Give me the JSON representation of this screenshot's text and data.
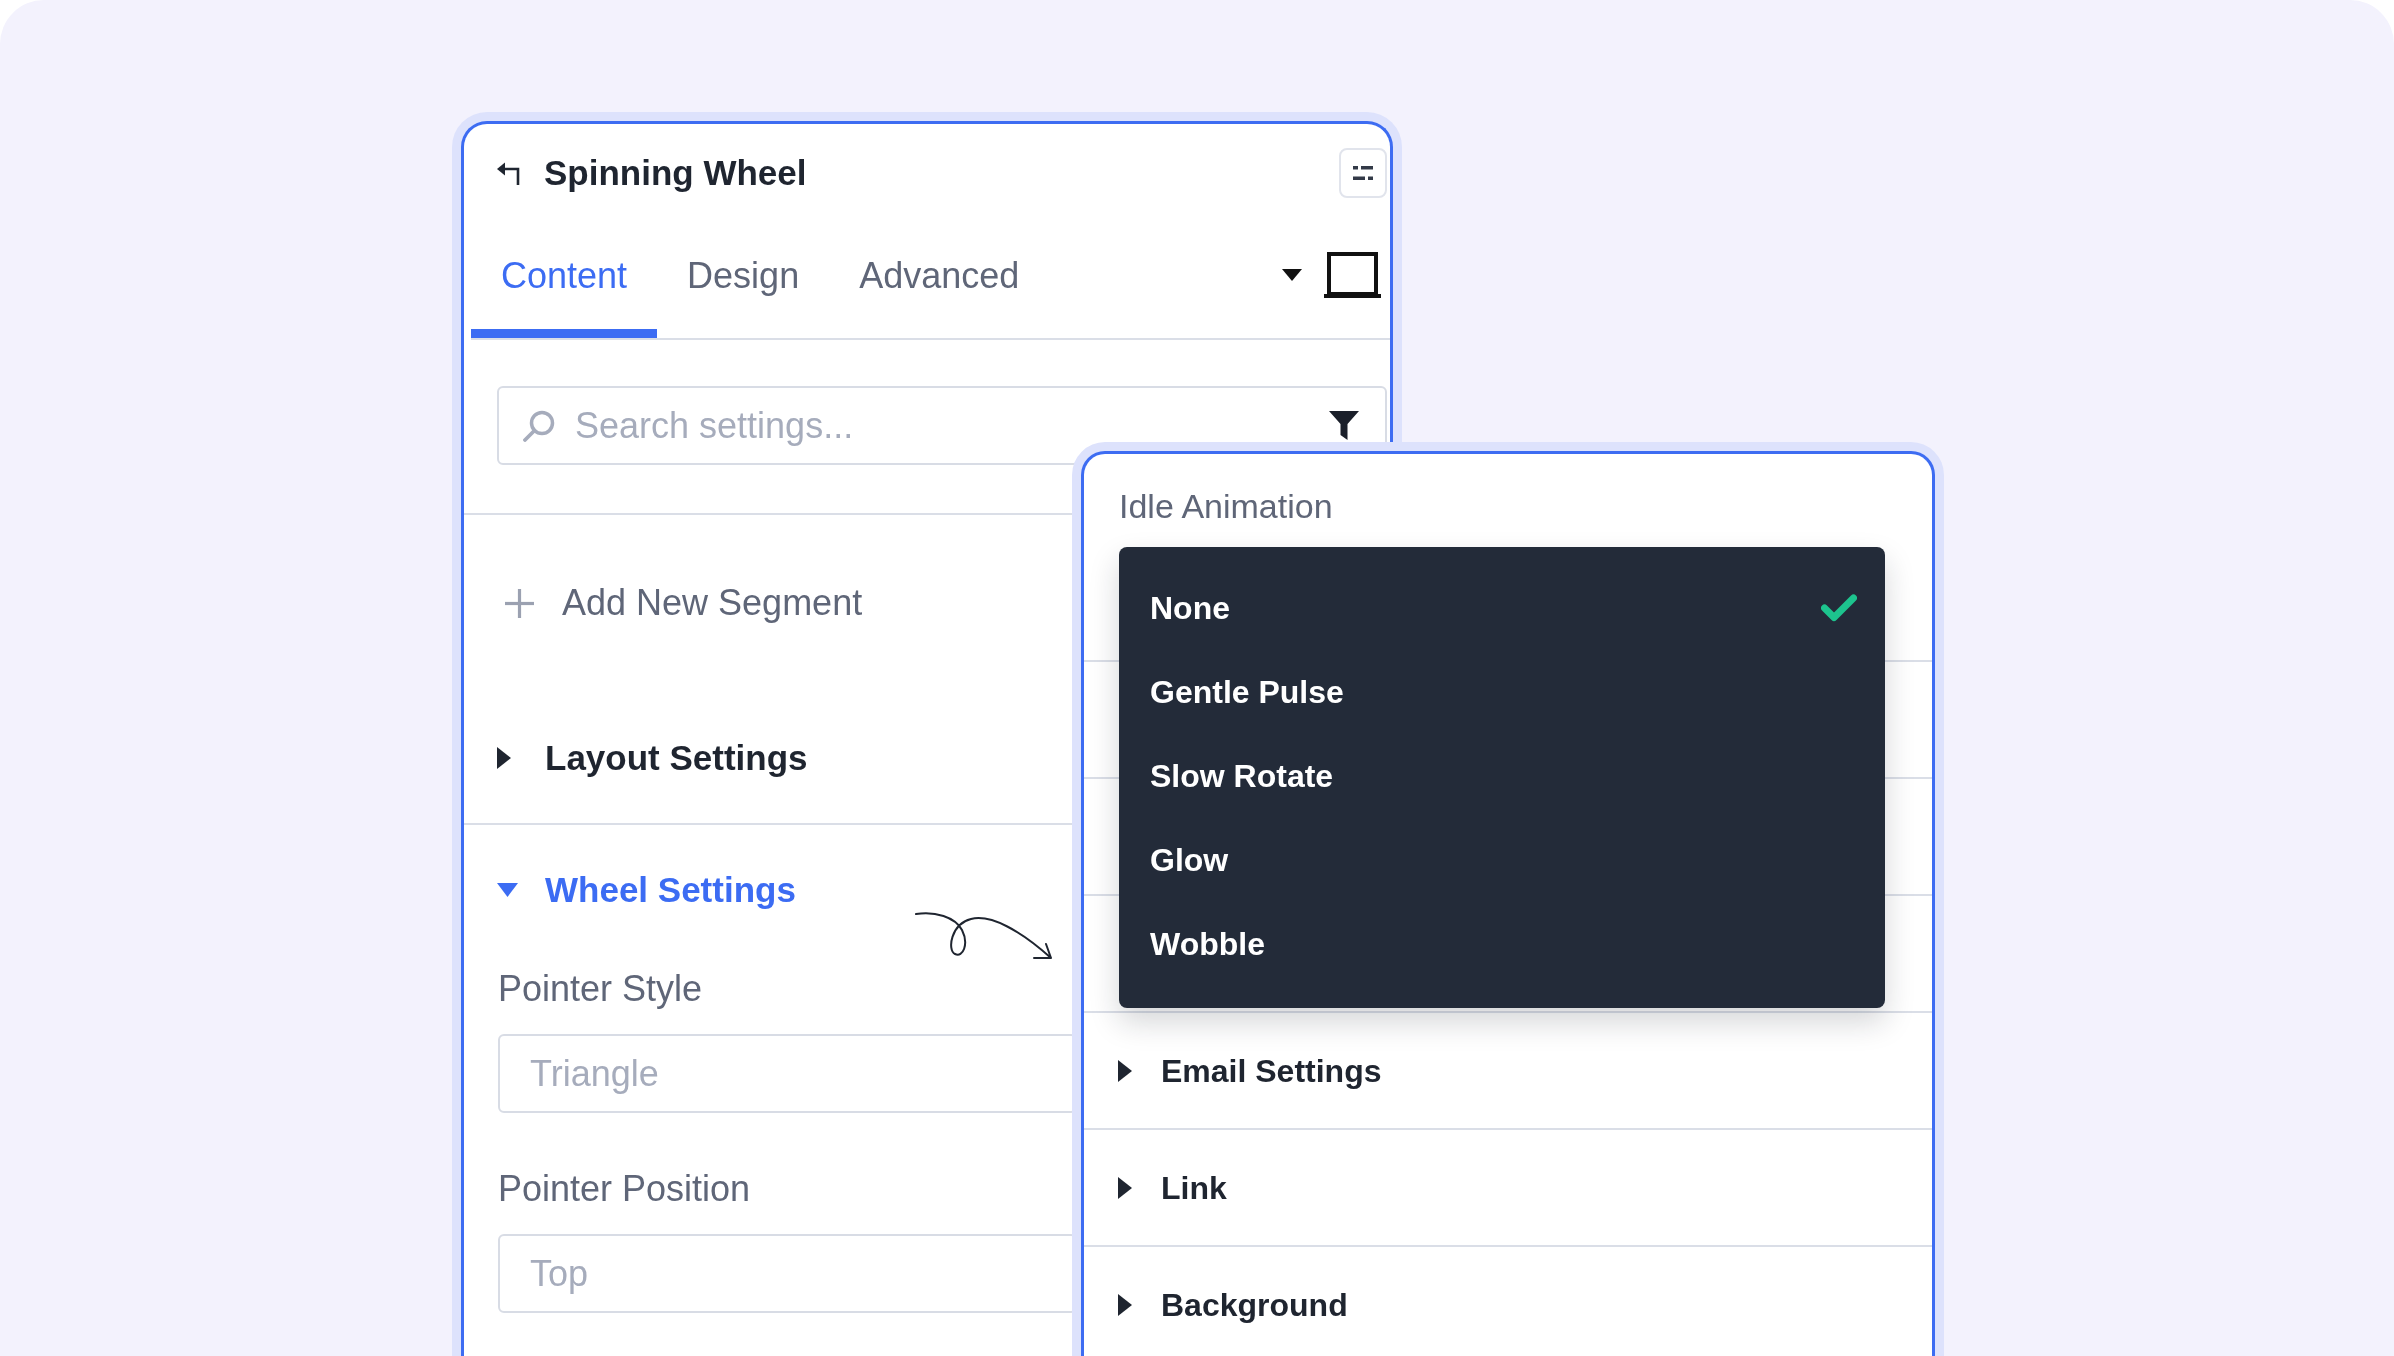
{
  "panel": {
    "title": "Spinning Wheel",
    "tabs": [
      {
        "label": "Content",
        "selected": true
      },
      {
        "label": "Design",
        "selected": false
      },
      {
        "label": "Advanced",
        "selected": false
      }
    ],
    "search": {
      "placeholder": "Search settings..."
    },
    "add_button": "Add New Segment",
    "sections": [
      {
        "title": "Layout Settings",
        "expanded": false
      },
      {
        "title": "Wheel Settings",
        "expanded": true,
        "fields": [
          {
            "label": "Pointer Style",
            "placeholder": "Triangle"
          },
          {
            "label": "Pointer Position",
            "placeholder": "Top"
          }
        ]
      }
    ]
  },
  "popup": {
    "label": "Idle Animation",
    "options": [
      {
        "label": "None",
        "selected": true
      },
      {
        "label": "Gentle Pulse",
        "selected": false
      },
      {
        "label": "Slow Rotate",
        "selected": false
      },
      {
        "label": "Glow",
        "selected": false
      },
      {
        "label": "Wobble",
        "selected": false
      }
    ],
    "sections": [
      {
        "title": "Email Settings",
        "expanded": false
      },
      {
        "title": "Link",
        "expanded": false
      },
      {
        "title": "Background",
        "expanded": false
      }
    ]
  }
}
